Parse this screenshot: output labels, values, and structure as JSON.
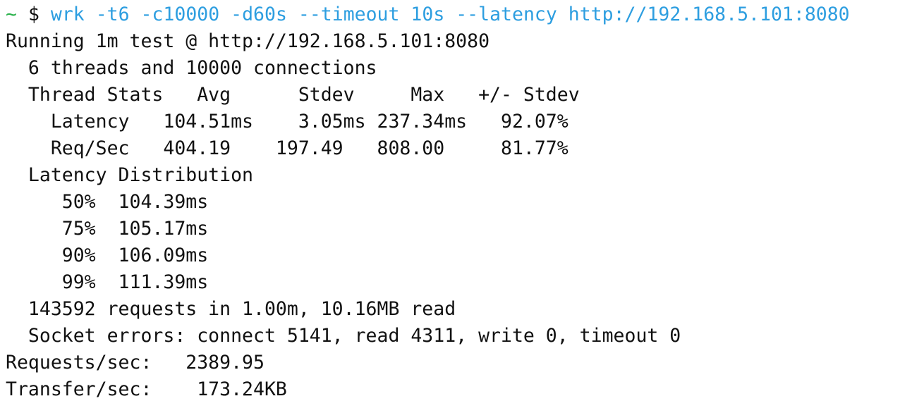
{
  "theme": {
    "background": "#ffffff",
    "text": "#111111",
    "prompt_tilde": "#2bb24c",
    "command": "#2d9ee0"
  },
  "prompt": {
    "cwd": "~",
    "symbol": "$",
    "command": "wrk -t6 -c10000 -d60s --timeout 10s --latency http://192.168.5.101:8080"
  },
  "output": {
    "running": "Running 1m test @ http://192.168.5.101:8080",
    "threads_line": "  6 threads and 10000 connections",
    "thread_stats_header": "  Thread Stats   Avg      Stdev     Max   +/- Stdev",
    "latency_row": "    Latency   104.51ms    3.05ms 237.34ms   92.07%",
    "reqsec_row": "    Req/Sec   404.19    197.49   808.00     81.77%",
    "latency_distribution_header": "  Latency Distribution",
    "p50": "     50%  104.39ms",
    "p75": "     75%  105.17ms",
    "p90": "     90%  106.09ms",
    "p99": "     99%  111.39ms",
    "summary": "  143592 requests in 1.00m, 10.16MB read",
    "socket_errors": "  Socket errors: connect 5141, read 4311, write 0, timeout 0",
    "requests_per_sec": "Requests/sec:   2389.95",
    "transfer_per_sec": "Transfer/sec:    173.24KB"
  }
}
